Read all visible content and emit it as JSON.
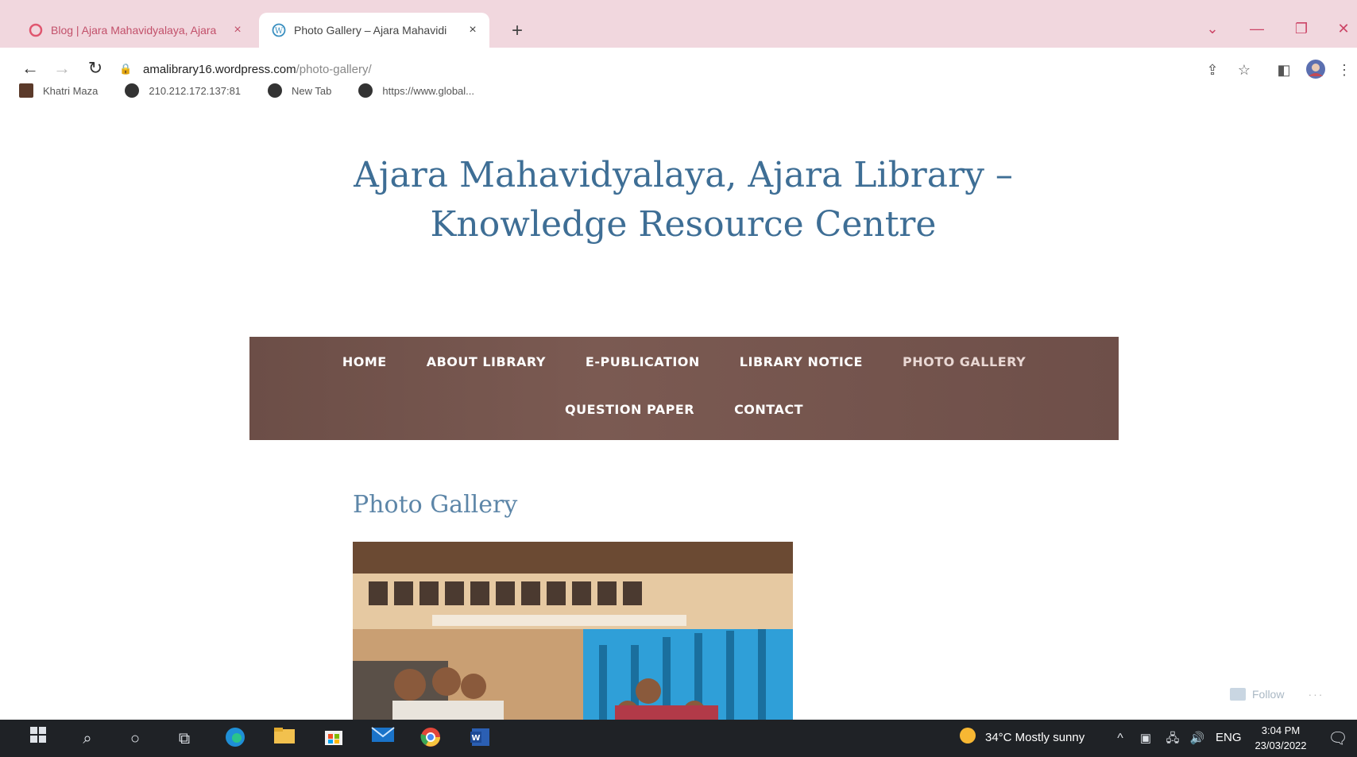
{
  "tabs": [
    {
      "title": "Blog | Ajara Mahavidyalaya, Ajara",
      "close": "×",
      "icon": "chrome-circle-icon"
    },
    {
      "title": "Photo Gallery – Ajara Mahavidi",
      "close": "×",
      "icon": "wordpress-icon"
    }
  ],
  "new_tab": "+",
  "window_controls": {
    "dropdown": "⌄",
    "minimize": "—",
    "restore": "❐",
    "close": "✕"
  },
  "address": {
    "host": "amalibrary16.wordpress.com",
    "path": "/photo-gallery/"
  },
  "bookmarks": [
    {
      "label": "Khatri Maza"
    },
    {
      "label": "210.212.172.137:81"
    },
    {
      "label": "New Tab"
    },
    {
      "label": "https://www.global..."
    }
  ],
  "site": {
    "title_line1": "Ajara Mahavidyalaya, Ajara Library –",
    "title_line2": "Knowledge Resource Centre"
  },
  "nav": {
    "row1": [
      {
        "label": "HOME"
      },
      {
        "label": "ABOUT LIBRARY"
      },
      {
        "label": "E-PUBLICATION"
      },
      {
        "label": "LIBRARY NOTICE"
      },
      {
        "label": "PHOTO GALLERY"
      }
    ],
    "row2": [
      {
        "label": "QUESTION PAPER"
      },
      {
        "label": "CONTACT"
      }
    ]
  },
  "page": {
    "title": "Photo Gallery",
    "follow_label": "Follow",
    "more": "···"
  },
  "taskbar": {
    "weather": "34°C  Mostly sunny",
    "language": "ENG",
    "time": "3:04 PM",
    "date": "23/03/2022"
  },
  "colors": {
    "tab_strip": "#f1d7de",
    "title_blue": "#3e6e95",
    "nav_brown": "#744f48",
    "taskbar": "#1f2226"
  }
}
